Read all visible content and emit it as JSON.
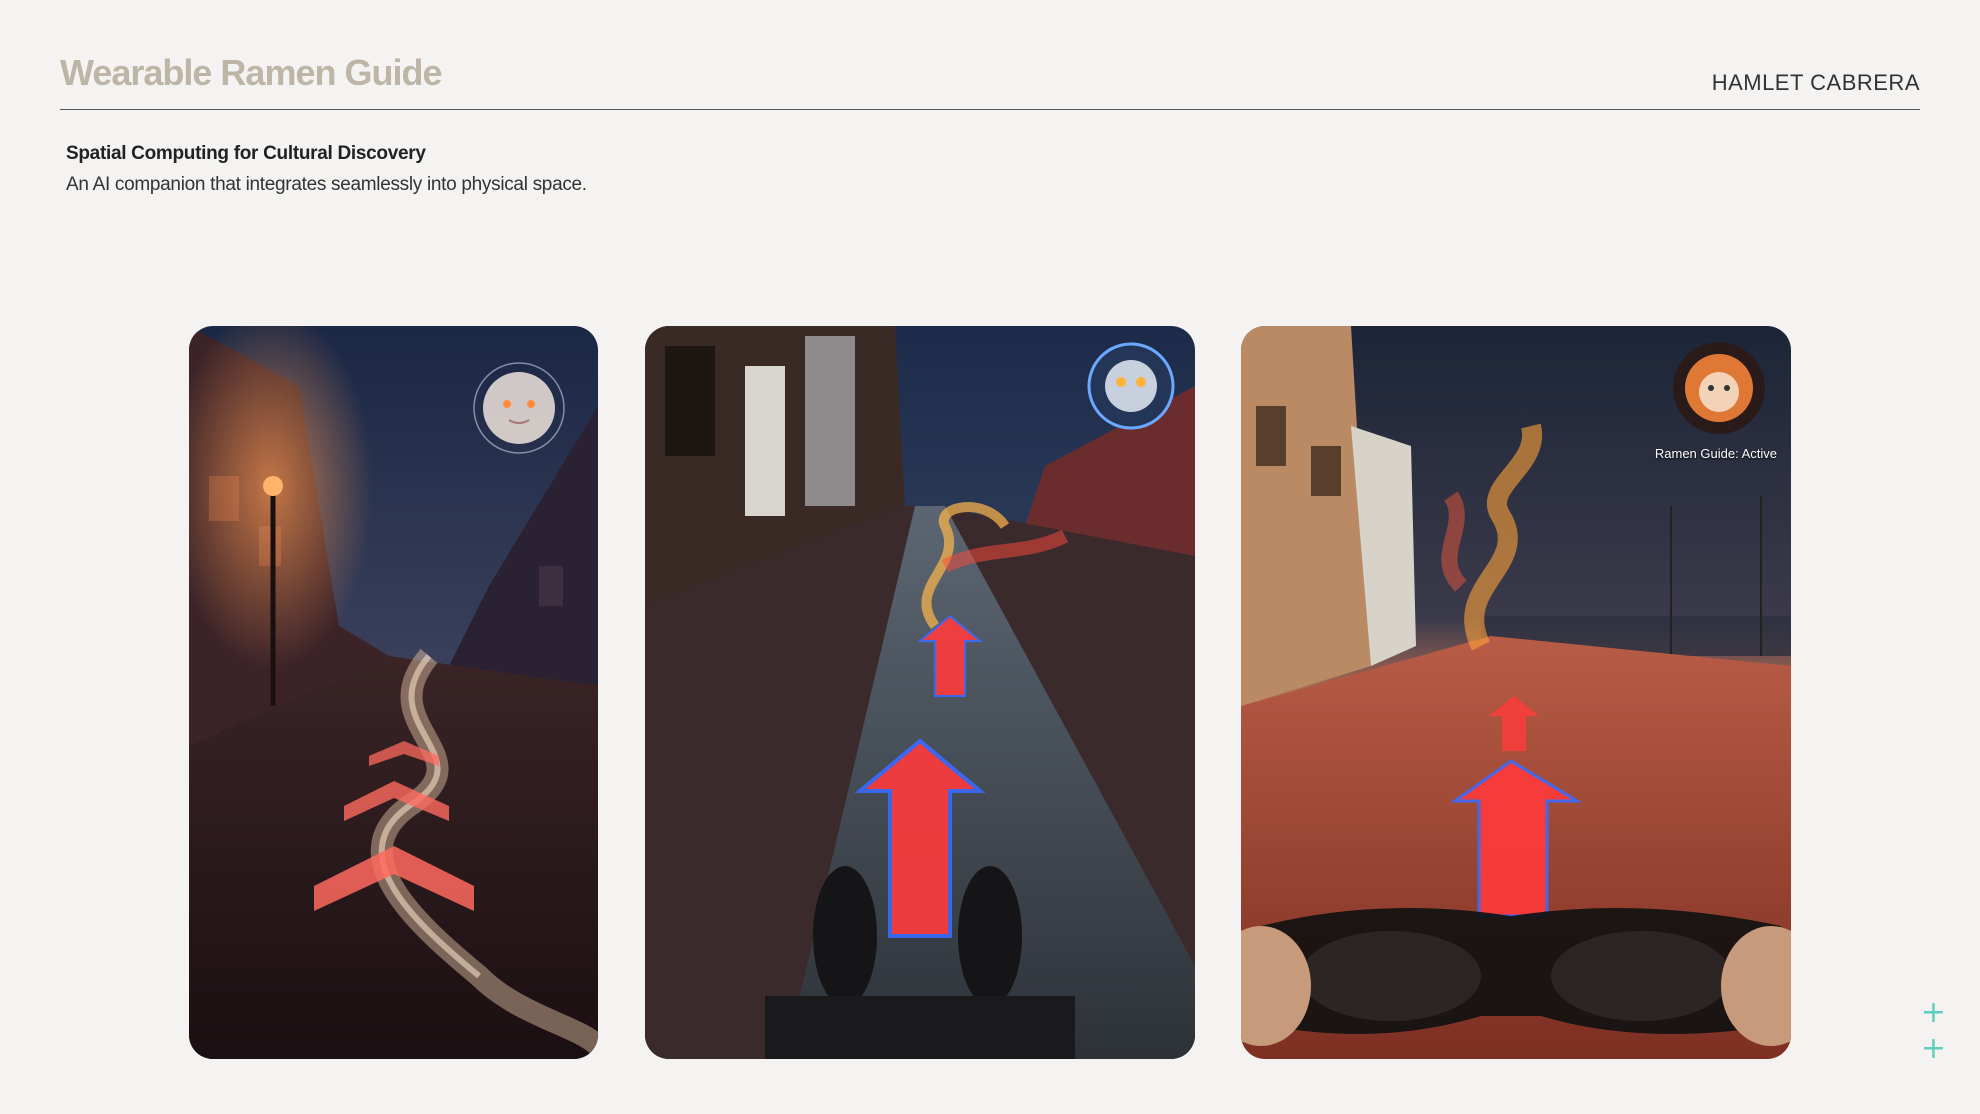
{
  "header": {
    "title": "Wearable Ramen Guide",
    "author": "HAMLET CABRERA"
  },
  "intro": {
    "subtitle": "Spatial Computing for Cultural Discovery",
    "description": "An AI companion that integrates seamlessly into physical space."
  },
  "panels": [
    {
      "scene": "night cobblestone street with smoke trail and chevron arrows",
      "avatar_icon": "smoke-spirit-avatar-icon"
    },
    {
      "scene": "sidewalk at dusk with red neon arrows and feet",
      "avatar_icon": "glowing-spirit-avatar-icon"
    },
    {
      "scene": "waterfront promenade at sunset with arrows and hands holding glasses",
      "avatar_icon": "fire-spirit-avatar-icon",
      "status_label": "Ramen Guide: Active"
    }
  ],
  "corner_icons": [
    "plus-icon",
    "plus-icon"
  ],
  "colors": {
    "accent": "#5ecfbf",
    "title": "#bdb5a6",
    "arrow": "#ff3b3b",
    "arrow_outline": "#3b6bff"
  }
}
